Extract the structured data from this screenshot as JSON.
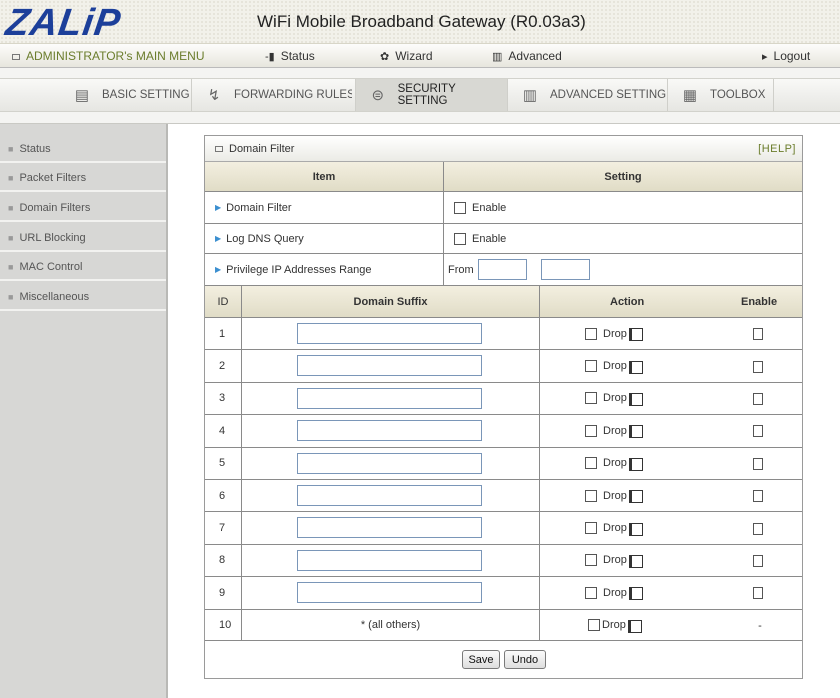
{
  "header": {
    "logo": "ZALiP",
    "title": "WiFi Mobile Broadband Gateway (R0.03a3)"
  },
  "menu": {
    "admin": "ADMINISTRATOR's MAIN MENU",
    "status": "Status",
    "wizard": "Wizard",
    "advanced": "Advanced",
    "logout": "Logout"
  },
  "tabs": [
    "BASIC SETTING",
    "FORWARDING RULES",
    "SECURITY SETTING",
    "ADVANCED SETTING",
    "TOOLBOX"
  ],
  "sidebar": [
    "Status",
    "Packet Filters",
    "Domain Filters",
    "URL Blocking",
    "MAC Control",
    "Miscellaneous"
  ],
  "panel": {
    "title": "Domain Filter",
    "help": "[HELP]",
    "col_item": "Item",
    "col_setting": "Setting",
    "rows": [
      {
        "label": "Domain Filter",
        "setting": "Enable"
      },
      {
        "label": "Log DNS Query",
        "setting": "Enable"
      },
      {
        "label": "Privilege IP Addresses Range",
        "setting": "From"
      }
    ],
    "table_headers": {
      "id": "ID",
      "suffix": "Domain Suffix",
      "action": "Action",
      "enable": "Enable"
    },
    "action_label": "Drop",
    "ids": [
      "1",
      "2",
      "3",
      "4",
      "5",
      "6",
      "7",
      "8",
      "9"
    ],
    "last_row": {
      "id": "10",
      "suffix": "* (all others)",
      "action": "Drop",
      "enable": "-"
    },
    "save": "Save",
    "undo": "Undo"
  }
}
